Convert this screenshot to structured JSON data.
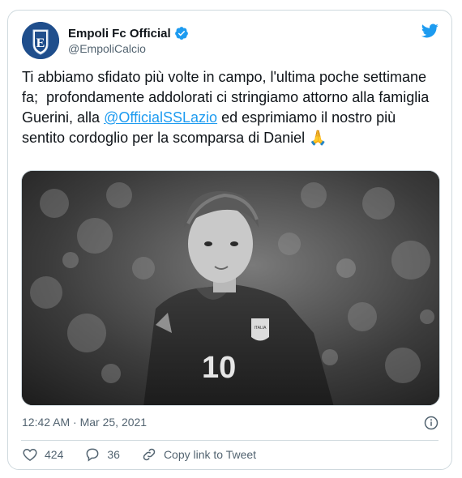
{
  "tweet": {
    "author_name": "Empoli Fc Official",
    "handle": "@EmpoliCalcio",
    "text_before": "Ti abbiamo sfidato più volte in campo, l'ultima poche settimane fa;  profondamente addolorati ci stringiamo attorno alla famiglia Guerini, alla ",
    "mention": "@OfficialSSLazio",
    "text_after": " ed esprimiamo il nostro più sentito cordoglio per la scomparsa di Daniel 🙏",
    "timestamp": "12:42 AM · Mar 25, 2021",
    "likes": "424",
    "replies": "36",
    "copy_link_label": "Copy link to Tweet"
  },
  "photo": {
    "shirt_number": "10",
    "badge_text": "ITALIA"
  },
  "icons": {
    "verified": "verified-badge-icon",
    "twitter": "twitter-bird-icon",
    "info": "info-icon",
    "like": "heart-icon",
    "reply": "reply-icon",
    "link": "link-icon"
  },
  "colors": {
    "accent": "#1d9bf0",
    "secondary_text": "#536471",
    "border": "#cfd9de",
    "avatar": "#1f4e8c"
  }
}
